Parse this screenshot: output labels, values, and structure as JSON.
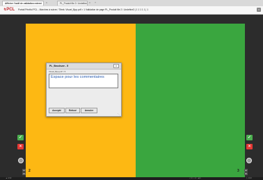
{
  "browser": {
    "tabs": [
      {
        "label": "Afficher l'outil de validation externi"
      },
      {
        "label": "PL_Produit file 2 / Undefine"
      }
    ],
    "tab_close_glyph": "×",
    "new_tab_glyph": "+"
  },
  "app": {
    "logo_text": "PCL",
    "header_title": "Portail Printful PCL - Marches à suivre / Titrek: Visuel_Bpp.pdf > 1     Validation de page PL_Produit file 2 / Undefine3  |  1  1  1  1  1  |  1",
    "close_glyph": "×"
  },
  "document": {
    "page_left_number": "2",
    "page_right_number": "3",
    "page_left_color": "#fdb813",
    "page_right_color": "#3aa63f"
  },
  "dialog": {
    "title": "PL_Brochure - 5",
    "close_glyph": "x",
    "subtitle": "Visuel_Bpp.pdf > 5",
    "comment_value": "Espace pour les commentaires",
    "buttons": {
      "accept": "Accepté",
      "refuse": "Refusé",
      "cancel": "Annuler"
    },
    "resize_glyph": "⋱"
  },
  "controls": {
    "approve_glyph": "✓",
    "reject_glyph": "×",
    "arrow_up": "▲",
    "arrow_down": "▼",
    "approve_color": "#4caf50",
    "reject_color": "#e53935"
  },
  "footer": {
    "left_text": "▲ 2/10",
    "mid_text": "◁ 1 ▷ 1 ▷ ◀ 1",
    "right_text": "▷ 1/10"
  }
}
